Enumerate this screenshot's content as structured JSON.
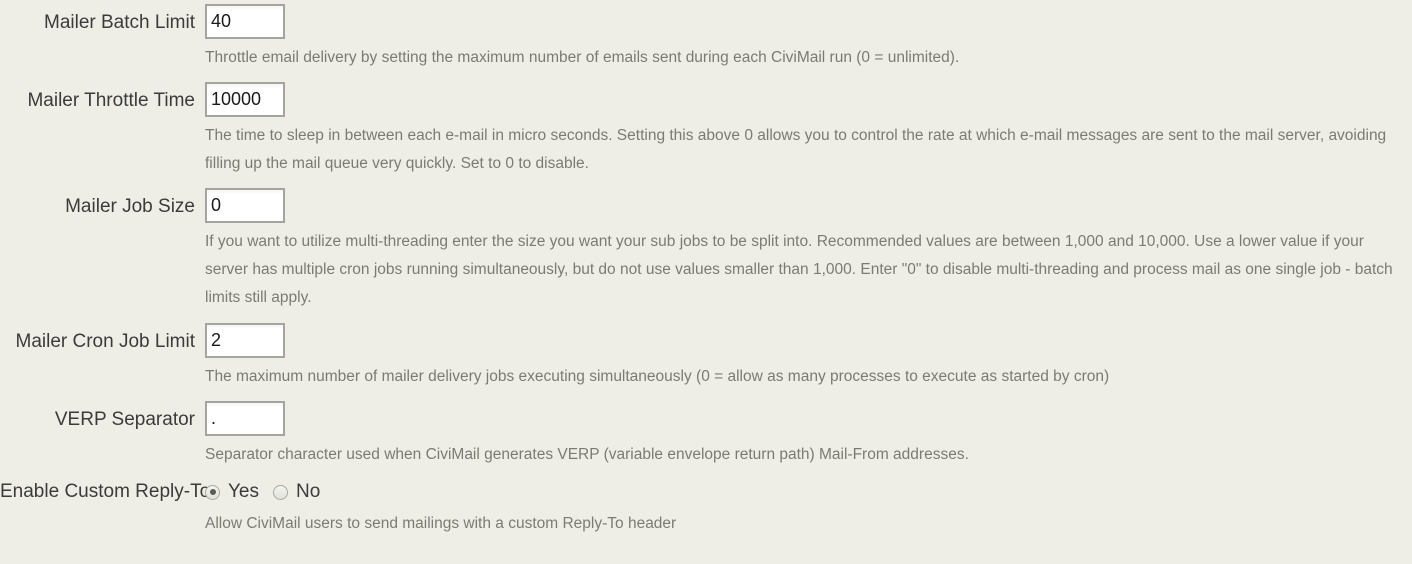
{
  "form": {
    "name": "civimail-component-settings",
    "background_color": "#efeee6",
    "label_color": "#3b3b3b",
    "description_color": "#7b7b72",
    "fields": [
      {
        "id": "mailer_batch_limit",
        "label": "Mailer Batch Limit",
        "type": "text",
        "value": "40",
        "description": "Throttle email delivery by setting the maximum number of emails sent during each CiviMail run (0 = unlimited)."
      },
      {
        "id": "mailer_throttle_time",
        "label": "Mailer Throttle Time",
        "type": "text",
        "value": "10000",
        "description": "The time to sleep in between each e-mail in micro seconds. Setting this above 0 allows you to control the rate at which e-mail messages are sent to the mail server, avoiding filling up the mail queue very quickly. Set to 0 to disable."
      },
      {
        "id": "mailer_job_size",
        "label": "Mailer Job Size",
        "type": "text",
        "value": "0",
        "description": "If you want to utilize multi-threading enter the size you want your sub jobs to be split into. Recommended values are between 1,000 and 10,000. Use a lower value if your server has multiple cron jobs running simultaneously, but do not use values smaller than 1,000. Enter \"0\" to disable multi-threading and process mail as one single job - batch limits still apply."
      },
      {
        "id": "mailer_cron_job_limit",
        "label": "Mailer Cron Job Limit",
        "type": "text",
        "value": "2",
        "description": "The maximum number of mailer delivery jobs executing simultaneously (0 = allow as many processes to execute as started by cron)"
      },
      {
        "id": "verp_separator",
        "label": "VERP Separator",
        "type": "text",
        "value": ".",
        "description": "Separator character used when CiviMail generates VERP (variable envelope return path) Mail-From addresses."
      },
      {
        "id": "enable_custom_reply_to",
        "label": "Enable Custom Reply-To",
        "type": "radio",
        "description": "Allow CiviMail users to send mailings with a custom Reply-To header",
        "options": [
          {
            "label": "Yes",
            "value": "1",
            "selected": true
          },
          {
            "label": "No",
            "value": "0",
            "selected": false
          }
        ]
      }
    ]
  }
}
